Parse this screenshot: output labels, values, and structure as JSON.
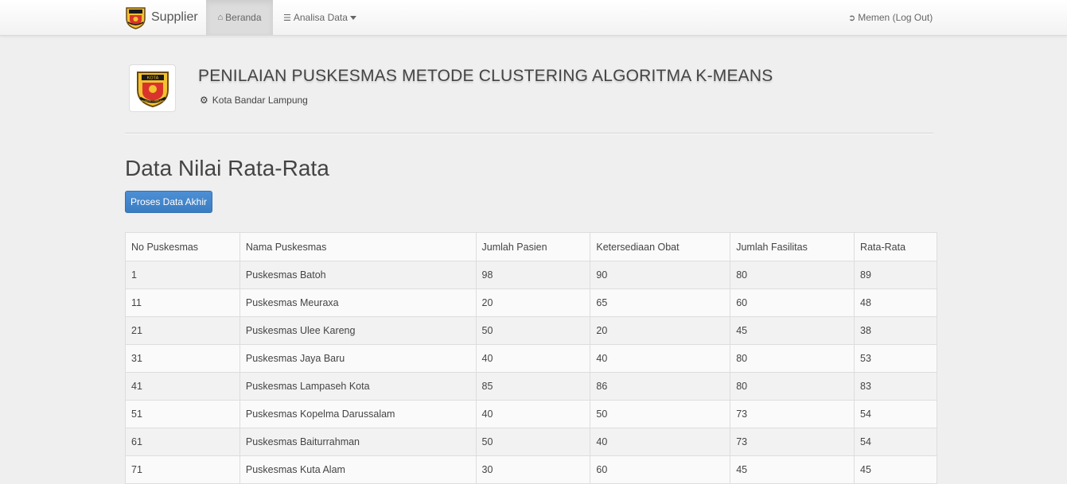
{
  "navbar": {
    "brand": "Supplier",
    "home": "Beranda",
    "analisa": "Analisa Data",
    "logout": "Memen (Log Out)"
  },
  "header": {
    "title": "PENILAIAN PUSKESMAS METODE CLUSTERING ALGORITMA K-MEANS",
    "subtitle": "Kota Bandar Lampung",
    "logo_text_top": "KOTA",
    "logo_text_bottom": "BANDAR LAMPUNG"
  },
  "page": {
    "title": "Data Nilai Rata-Rata",
    "button": "Proses Data Akhir"
  },
  "table": {
    "columns": [
      "No Puskesmas",
      "Nama Puskesmas",
      "Jumlah Pasien",
      "Ketersediaan Obat",
      "Jumlah Fasilitas",
      "Rata-Rata"
    ],
    "rows": [
      [
        "1",
        "Puskesmas Batoh",
        "98",
        "90",
        "80",
        "89"
      ],
      [
        "11",
        "Puskesmas Meuraxa",
        "20",
        "65",
        "60",
        "48"
      ],
      [
        "21",
        "Puskesmas Ulee Kareng",
        "50",
        "20",
        "45",
        "38"
      ],
      [
        "31",
        "Puskesmas Jaya Baru",
        "40",
        "40",
        "80",
        "53"
      ],
      [
        "41",
        "Puskesmas Lampaseh Kota",
        "85",
        "86",
        "80",
        "83"
      ],
      [
        "51",
        "Puskesmas Kopelma Darussalam",
        "40",
        "50",
        "73",
        "54"
      ],
      [
        "61",
        "Puskesmas Baiturrahman",
        "50",
        "40",
        "73",
        "54"
      ],
      [
        "71",
        "Puskesmas Kuta Alam",
        "30",
        "60",
        "45",
        "45"
      ]
    ]
  },
  "colors": {
    "button": "#428bca",
    "nav_active": "#dcdcdc",
    "background": "#efefef"
  },
  "icons": {
    "brand": "city-emblem-icon",
    "home": "home-icon",
    "analisa": "list-icon",
    "logout": "logout-icon",
    "subtitle": "gear-icon"
  }
}
